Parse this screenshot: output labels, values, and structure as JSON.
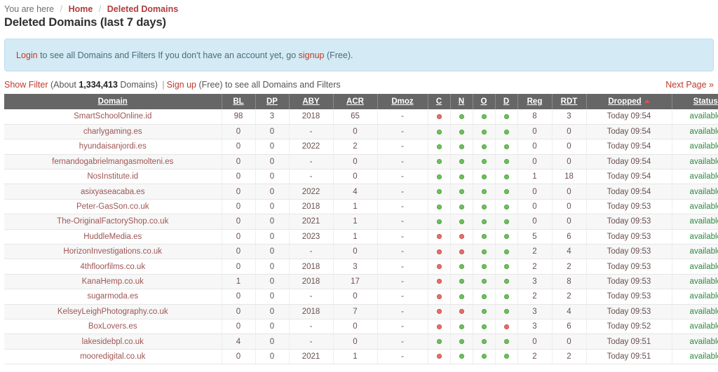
{
  "breadcrumb": {
    "prefix": "You are here",
    "separator": "/",
    "home_label": "Home",
    "current_label": "Deleted Domains"
  },
  "page_title": "Deleted Domains (last 7 days)",
  "alert": {
    "login_label": "Login",
    "text_middle": " to see all Domains and Filters If you don't have an account yet, go ",
    "signup_label": "signup",
    "text_end": " (Free)."
  },
  "filterbar": {
    "show_filter_label": "Show Filter",
    "about_prefix": " (About ",
    "domain_count": "1,334,413",
    "about_suffix": " Domains) ",
    "pipe": "|",
    "signup_label": "Sign up",
    "tail": " (Free) to see all Domains and Filters",
    "next_page_label": "Next Page »"
  },
  "table": {
    "columns": [
      {
        "key": "domain",
        "label": "Domain"
      },
      {
        "key": "bl",
        "label": "BL"
      },
      {
        "key": "dp",
        "label": "DP"
      },
      {
        "key": "aby",
        "label": "ABY"
      },
      {
        "key": "acr",
        "label": "ACR"
      },
      {
        "key": "dmoz",
        "label": "Dmoz"
      },
      {
        "key": "c",
        "label": "C"
      },
      {
        "key": "n",
        "label": "N"
      },
      {
        "key": "o",
        "label": "O"
      },
      {
        "key": "d",
        "label": "D"
      },
      {
        "key": "reg",
        "label": "Reg"
      },
      {
        "key": "rdt",
        "label": "RDT"
      },
      {
        "key": "dropped",
        "label": "Dropped"
      },
      {
        "key": "status",
        "label": "Status"
      }
    ],
    "sorted_column": "dropped",
    "sort_direction": "asc",
    "rows": [
      {
        "domain": "SmartSchoolOnline.id",
        "bl": "98",
        "dp": "3",
        "aby": "2018",
        "acr": "65",
        "dmoz": "-",
        "c": "red",
        "n": "green",
        "o": "green",
        "d": "green",
        "reg": "8",
        "rdt": "3",
        "dropped": "Today 09:54",
        "status": "available"
      },
      {
        "domain": "charlygaming.es",
        "bl": "0",
        "dp": "0",
        "aby": "-",
        "acr": "0",
        "dmoz": "-",
        "c": "green",
        "n": "green",
        "o": "green",
        "d": "green",
        "reg": "0",
        "rdt": "0",
        "dropped": "Today 09:54",
        "status": "available"
      },
      {
        "domain": "hyundaisanjordi.es",
        "bl": "0",
        "dp": "0",
        "aby": "2022",
        "acr": "2",
        "dmoz": "-",
        "c": "green",
        "n": "green",
        "o": "green",
        "d": "green",
        "reg": "0",
        "rdt": "0",
        "dropped": "Today 09:54",
        "status": "available"
      },
      {
        "domain": "fernandogabrielmangasmolteni.es",
        "bl": "0",
        "dp": "0",
        "aby": "-",
        "acr": "0",
        "dmoz": "-",
        "c": "green",
        "n": "green",
        "o": "green",
        "d": "green",
        "reg": "0",
        "rdt": "0",
        "dropped": "Today 09:54",
        "status": "available"
      },
      {
        "domain": "NosInstitute.id",
        "bl": "0",
        "dp": "0",
        "aby": "-",
        "acr": "0",
        "dmoz": "-",
        "c": "green",
        "n": "green",
        "o": "green",
        "d": "green",
        "reg": "1",
        "rdt": "18",
        "dropped": "Today 09:54",
        "status": "available"
      },
      {
        "domain": "asixyaseacaba.es",
        "bl": "0",
        "dp": "0",
        "aby": "2022",
        "acr": "4",
        "dmoz": "-",
        "c": "green",
        "n": "green",
        "o": "green",
        "d": "green",
        "reg": "0",
        "rdt": "0",
        "dropped": "Today 09:54",
        "status": "available"
      },
      {
        "domain": "Peter-GasSon.co.uk",
        "bl": "0",
        "dp": "0",
        "aby": "2018",
        "acr": "1",
        "dmoz": "-",
        "c": "green",
        "n": "green",
        "o": "green",
        "d": "green",
        "reg": "0",
        "rdt": "0",
        "dropped": "Today 09:53",
        "status": "available"
      },
      {
        "domain": "The-OriginalFactoryShop.co.uk",
        "bl": "0",
        "dp": "0",
        "aby": "2021",
        "acr": "1",
        "dmoz": "-",
        "c": "green",
        "n": "green",
        "o": "green",
        "d": "green",
        "reg": "0",
        "rdt": "0",
        "dropped": "Today 09:53",
        "status": "available"
      },
      {
        "domain": "HuddleMedia.es",
        "bl": "0",
        "dp": "0",
        "aby": "2023",
        "acr": "1",
        "dmoz": "-",
        "c": "red",
        "n": "red",
        "o": "green",
        "d": "green",
        "reg": "5",
        "rdt": "6",
        "dropped": "Today 09:53",
        "status": "available"
      },
      {
        "domain": "HorizonInvestigations.co.uk",
        "bl": "0",
        "dp": "0",
        "aby": "-",
        "acr": "0",
        "dmoz": "-",
        "c": "red",
        "n": "red",
        "o": "green",
        "d": "green",
        "reg": "2",
        "rdt": "4",
        "dropped": "Today 09:53",
        "status": "available"
      },
      {
        "domain": "4thfloorfilms.co.uk",
        "bl": "0",
        "dp": "0",
        "aby": "2018",
        "acr": "3",
        "dmoz": "-",
        "c": "red",
        "n": "green",
        "o": "green",
        "d": "green",
        "reg": "2",
        "rdt": "2",
        "dropped": "Today 09:53",
        "status": "available"
      },
      {
        "domain": "KanaHemp.co.uk",
        "bl": "1",
        "dp": "0",
        "aby": "2018",
        "acr": "17",
        "dmoz": "-",
        "c": "red",
        "n": "green",
        "o": "green",
        "d": "green",
        "reg": "3",
        "rdt": "8",
        "dropped": "Today 09:53",
        "status": "available"
      },
      {
        "domain": "sugarmoda.es",
        "bl": "0",
        "dp": "0",
        "aby": "-",
        "acr": "0",
        "dmoz": "-",
        "c": "red",
        "n": "green",
        "o": "green",
        "d": "green",
        "reg": "2",
        "rdt": "2",
        "dropped": "Today 09:53",
        "status": "available"
      },
      {
        "domain": "KelseyLeighPhotography.co.uk",
        "bl": "0",
        "dp": "0",
        "aby": "2018",
        "acr": "7",
        "dmoz": "-",
        "c": "red",
        "n": "red",
        "o": "green",
        "d": "green",
        "reg": "3",
        "rdt": "4",
        "dropped": "Today 09:53",
        "status": "available"
      },
      {
        "domain": "BoxLovers.es",
        "bl": "0",
        "dp": "0",
        "aby": "-",
        "acr": "0",
        "dmoz": "-",
        "c": "red",
        "n": "green",
        "o": "green",
        "d": "red",
        "reg": "3",
        "rdt": "6",
        "dropped": "Today 09:52",
        "status": "available"
      },
      {
        "domain": "lakesidebpl.co.uk",
        "bl": "4",
        "dp": "0",
        "aby": "-",
        "acr": "0",
        "dmoz": "-",
        "c": "green",
        "n": "green",
        "o": "green",
        "d": "green",
        "reg": "0",
        "rdt": "0",
        "dropped": "Today 09:51",
        "status": "available"
      },
      {
        "domain": "mooredigital.co.uk",
        "bl": "0",
        "dp": "0",
        "aby": "2021",
        "acr": "1",
        "dmoz": "-",
        "c": "red",
        "n": "green",
        "o": "green",
        "d": "green",
        "reg": "2",
        "rdt": "2",
        "dropped": "Today 09:51",
        "status": "available"
      }
    ]
  }
}
